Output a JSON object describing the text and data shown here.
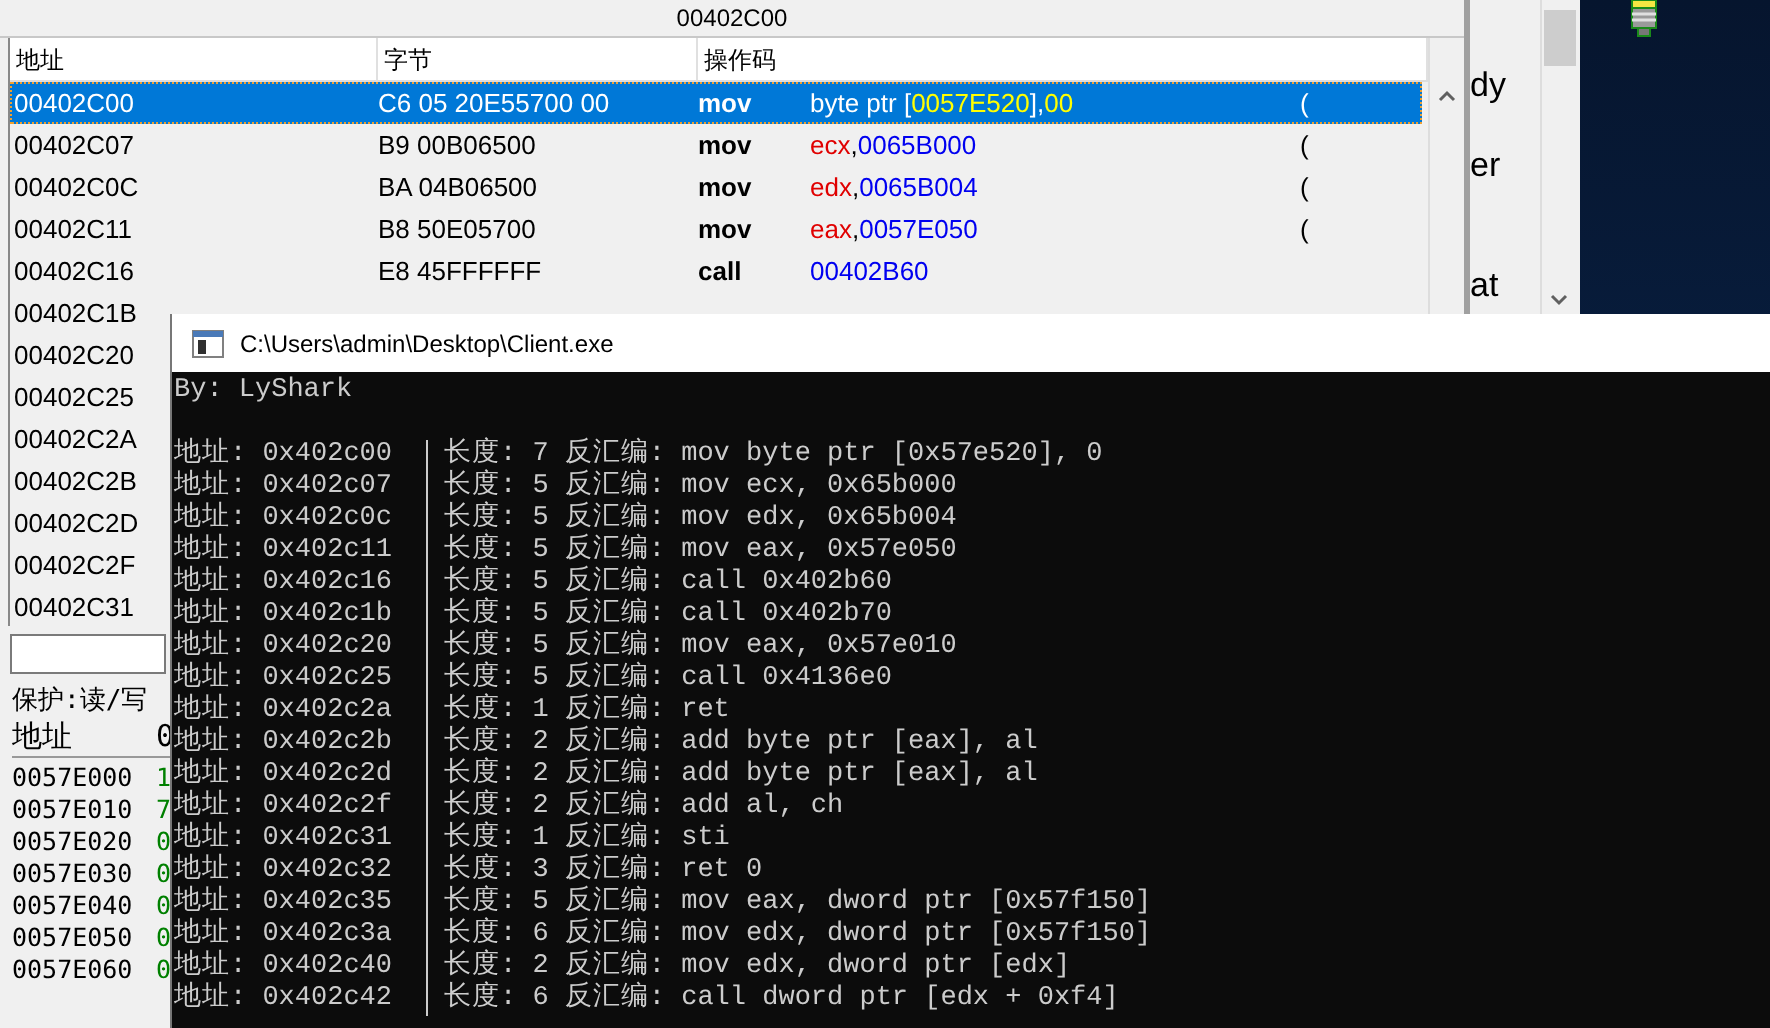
{
  "disassembler": {
    "address_bar": "00402C00",
    "columns": [
      "地址",
      "字节",
      "操作码"
    ],
    "rows": [
      {
        "address": "00402C00",
        "bytes": "C6 05 20E55700 00",
        "mnemonic": "mov",
        "operands": [
          {
            "kind": "text",
            "text": "byte ptr ["
          },
          {
            "kind": "num",
            "text": "0057E520"
          },
          {
            "kind": "text",
            "text": "],"
          },
          {
            "kind": "num",
            "text": "00"
          }
        ],
        "column_4": "(",
        "selected": true
      },
      {
        "address": "00402C07",
        "bytes": "B9 00B06500",
        "mnemonic": "mov",
        "operands": [
          {
            "kind": "reg",
            "text": "ecx"
          },
          {
            "kind": "text",
            "text": ","
          },
          {
            "kind": "num",
            "text": "0065B000"
          }
        ],
        "column_4": "(",
        "selected": false
      },
      {
        "address": "00402C0C",
        "bytes": "BA 04B06500",
        "mnemonic": "mov",
        "operands": [
          {
            "kind": "reg",
            "text": "edx"
          },
          {
            "kind": "text",
            "text": ","
          },
          {
            "kind": "num",
            "text": "0065B004"
          }
        ],
        "column_4": "(",
        "selected": false
      },
      {
        "address": "00402C11",
        "bytes": "B8 50E05700",
        "mnemonic": "mov",
        "operands": [
          {
            "kind": "reg",
            "text": "eax"
          },
          {
            "kind": "text",
            "text": ","
          },
          {
            "kind": "num",
            "text": "0057E050"
          }
        ],
        "column_4": "(",
        "selected": false
      },
      {
        "address": "00402C16",
        "bytes": "E8 45FFFFFF",
        "mnemonic": "call",
        "operands": [
          {
            "kind": "num",
            "text": "00402B60"
          }
        ],
        "selected": false
      },
      {
        "address": "00402C1B",
        "selected": false
      },
      {
        "address": "00402C20",
        "selected": false
      },
      {
        "address": "00402C25",
        "selected": false
      },
      {
        "address": "00402C2A",
        "selected": false
      },
      {
        "address": "00402C2B",
        "selected": false
      },
      {
        "address": "00402C2D",
        "selected": false
      },
      {
        "address": "00402C2F",
        "selected": false
      },
      {
        "address": "00402C31",
        "selected": false
      }
    ]
  },
  "memory": {
    "protection": "保护:读/写",
    "columns": [
      "地址",
      "0"
    ],
    "rows": [
      {
        "address": "0057E000",
        "column_2": "1"
      },
      {
        "address": "0057E010",
        "column_2": "7"
      },
      {
        "address": "0057E020",
        "column_2": "0"
      },
      {
        "address": "0057E030",
        "column_2": "0"
      },
      {
        "address": "0057E040",
        "column_2": "0"
      },
      {
        "address": "0057E050",
        "column_2": "0"
      },
      {
        "address": "0057E060",
        "column_2": "0"
      }
    ]
  },
  "side_panel": {
    "texts": [
      "dy",
      "er",
      "at"
    ]
  },
  "console": {
    "title": "C:\\Users\\admin\\Desktop\\Client.exe",
    "header": "By: LyShark",
    "lines": [
      {
        "address": "地址: 0x402c00",
        "info": "长度: 7 反汇编: mov byte ptr [0x57e520], 0"
      },
      {
        "address": "地址: 0x402c07",
        "info": "长度: 5 反汇编: mov ecx, 0x65b000"
      },
      {
        "address": "地址: 0x402c0c",
        "info": "长度: 5 反汇编: mov edx, 0x65b004"
      },
      {
        "address": "地址: 0x402c11",
        "info": "长度: 5 反汇编: mov eax, 0x57e050"
      },
      {
        "address": "地址: 0x402c16",
        "info": "长度: 5 反汇编: call 0x402b60"
      },
      {
        "address": "地址: 0x402c1b",
        "info": "长度: 5 反汇编: call 0x402b70"
      },
      {
        "address": "地址: 0x402c20",
        "info": "长度: 5 反汇编: mov eax, 0x57e010"
      },
      {
        "address": "地址: 0x402c25",
        "info": "长度: 5 反汇编: call 0x4136e0"
      },
      {
        "address": "地址: 0x402c2a",
        "info": "长度: 1 反汇编: ret"
      },
      {
        "address": "地址: 0x402c2b",
        "info": "长度: 2 反汇编: add byte ptr [eax], al"
      },
      {
        "address": "地址: 0x402c2d",
        "info": "长度: 2 反汇编: add byte ptr [eax], al"
      },
      {
        "address": "地址: 0x402c2f",
        "info": "长度: 2 反汇编: add al, ch"
      },
      {
        "address": "地址: 0x402c31",
        "info": "长度: 1 反汇编: sti"
      },
      {
        "address": "地址: 0x402c32",
        "info": "长度: 3 反汇编: ret 0"
      },
      {
        "address": "地址: 0x402c35",
        "info": "长度: 5 反汇编: mov eax, dword ptr [0x57f150]"
      },
      {
        "address": "地址: 0x402c3a",
        "info": "长度: 6 反汇编: mov edx, dword ptr [0x57f150]"
      },
      {
        "address": "地址: 0x402c40",
        "info": "长度: 2 反汇编: mov edx, dword ptr [edx]"
      },
      {
        "address": "地址: 0x402c42",
        "info": "长度: 6 反汇编: call dword ptr [edx + 0xf4]"
      }
    ]
  }
}
